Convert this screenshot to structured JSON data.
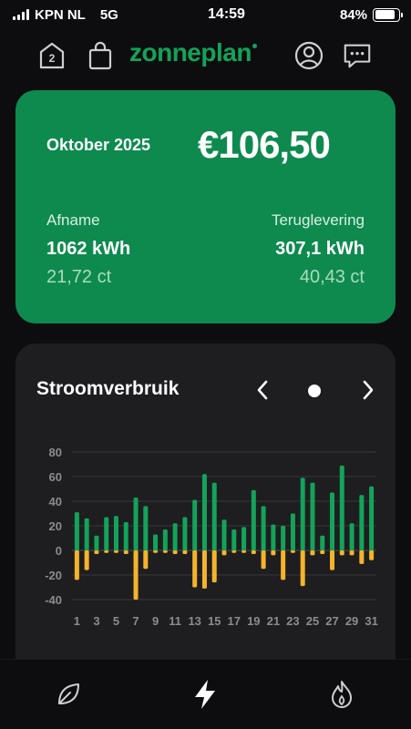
{
  "status_bar": {
    "carrier": "KPN NL",
    "network": "5G",
    "time": "14:59",
    "battery": "84%",
    "battery_level": 0.84
  },
  "header": {
    "brand": "zonneplan",
    "house_badge": "2",
    "icons": [
      "house-icon",
      "shopping-bag-icon",
      "account-icon",
      "chat-icon"
    ]
  },
  "summary": {
    "month": "Oktober 2025",
    "amount": "€106,50",
    "afname": {
      "label": "Afname",
      "kwh": "1062 kWh",
      "price": "21,72 ct"
    },
    "teruglevering": {
      "label": "Teruglevering",
      "kwh": "307,1 kWh",
      "price": "40,43 ct"
    }
  },
  "chart_card": {
    "title": "Stroomverbruik"
  },
  "chart_data": {
    "type": "bar",
    "title": "Stroomverbruik",
    "xlabel": "",
    "ylabel": "",
    "ylim": [
      -40,
      80
    ],
    "yticks": [
      80,
      60,
      40,
      20,
      0,
      -20,
      -40
    ],
    "x": [
      1,
      2,
      3,
      4,
      5,
      6,
      7,
      8,
      9,
      10,
      11,
      12,
      13,
      14,
      15,
      16,
      17,
      18,
      19,
      20,
      21,
      22,
      23,
      24,
      25,
      26,
      27,
      28,
      29,
      30,
      31
    ],
    "xtick_labels": [
      "1",
      "3",
      "5",
      "7",
      "9",
      "11",
      "13",
      "15",
      "17",
      "19",
      "21",
      "23",
      "25",
      "27",
      "29",
      "31"
    ],
    "grid": true,
    "legend": "none",
    "series": [
      {
        "color": "#13a35a",
        "values": [
          31,
          26,
          12,
          27,
          28,
          23,
          43,
          36,
          13,
          17,
          22,
          27,
          41,
          62,
          55,
          25,
          17,
          19,
          49,
          36,
          21,
          20,
          30,
          59,
          55,
          12,
          47,
          69,
          22,
          45,
          52
        ]
      },
      {
        "color": "#f5b32c",
        "values": [
          -24,
          -16,
          -3,
          -2,
          -2,
          -3,
          -40,
          -15,
          -2,
          -2,
          -3,
          -3,
          -30,
          -31,
          -26,
          -4,
          -2,
          -2,
          -3,
          -15,
          -4,
          -24,
          -2,
          -29,
          -4,
          -3,
          -16,
          -4,
          -4,
          -11,
          -8
        ]
      }
    ]
  },
  "bottom_nav": {
    "tabs": [
      "leaf-icon",
      "bolt-icon",
      "flame-icon"
    ]
  }
}
